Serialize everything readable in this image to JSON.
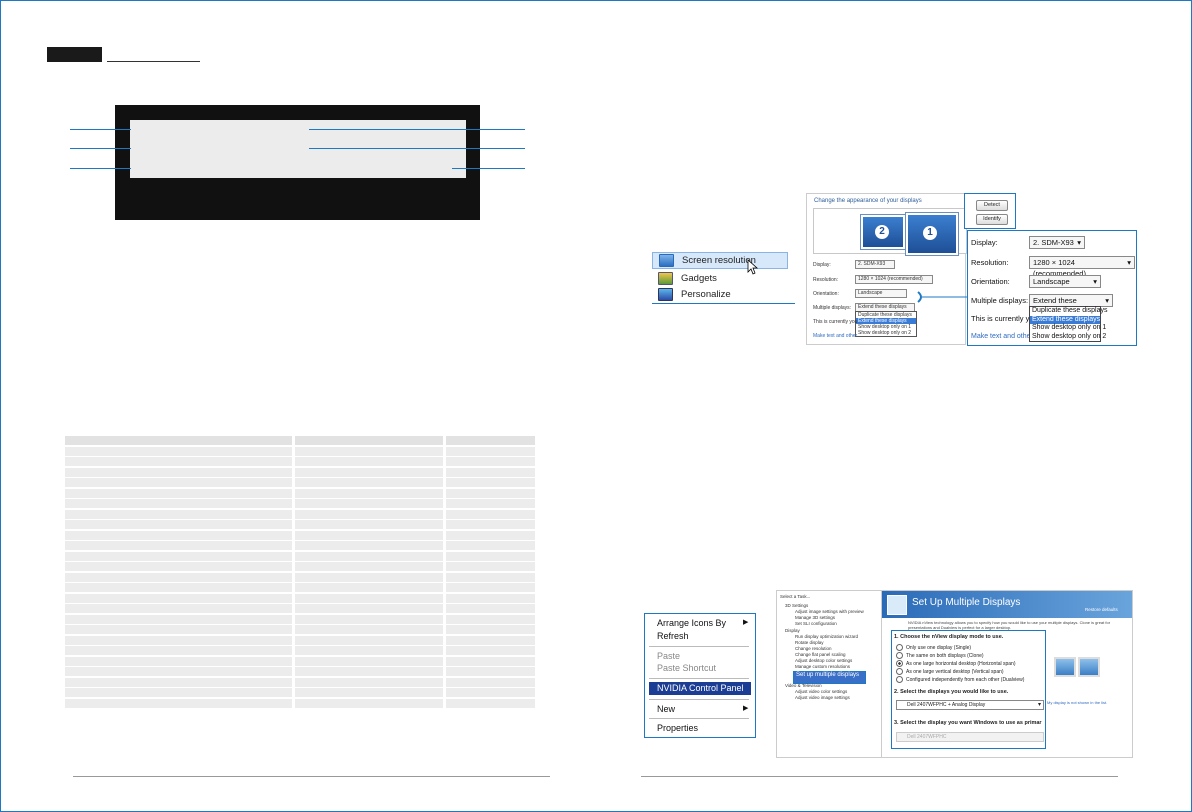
{
  "right_top": {
    "context_menu": {
      "items": [
        {
          "label": "Screen resolution",
          "icon": "screen-resolution-icon"
        },
        {
          "label": "Gadgets",
          "icon": "gadgets-icon"
        },
        {
          "label": "Personalize",
          "icon": "personalize-icon"
        }
      ]
    },
    "dialog": {
      "title": "Change the appearance of your displays",
      "monitor_1": "1",
      "monitor_2": "2",
      "display_label": "Display:",
      "display_value": "2. SDM-X93",
      "resolution_label": "Resolution:",
      "resolution_value": "1280 × 1024 (recommended)",
      "orientation_label": "Orientation:",
      "orientation_value": "Landscape",
      "multiple_label": "Multiple displays:",
      "multiple_value": "Extend these displays",
      "options": [
        "Duplicate these displays",
        "Extend these displays",
        "Show desktop only on 1",
        "Show desktop only on 2"
      ],
      "currently_text": "This is currently you",
      "link_text": "Make text and other"
    },
    "buttons": {
      "detect": "Detect",
      "identify": "Identify"
    },
    "zoom": {
      "display_label": "Display:",
      "display_value": "2. SDM-X93",
      "resolution_label": "Resolution:",
      "resolution_value": "1280 × 1024 (recommended)",
      "orientation_label": "Orientation:",
      "orientation_value": "Landscape",
      "multiple_label": "Multiple displays:",
      "multiple_value": "Extend these displays",
      "options": [
        "Duplicate these displays",
        "Extend these displays",
        "Show desktop only on 1",
        "Show desktop only on 2"
      ],
      "currently_text": "This is currently you",
      "link_text": "Make text and other"
    }
  },
  "right_bottom": {
    "context_menu": {
      "arrange": "Arrange Icons By",
      "refresh": "Refresh",
      "paste": "Paste",
      "paste_shortcut": "Paste Shortcut",
      "nvidia": "NVIDIA Control Panel",
      "new": "New",
      "properties": "Properties"
    },
    "tree": {
      "header": "Select a Task...",
      "items": [
        "3D Settings",
        "Adjust image settings with preview",
        "Manage 3D settings",
        "Set SLI configuration",
        "Display",
        "Run display optimization wizard",
        "Rotate display",
        "Change resolution",
        "Change flat panel scaling",
        "Adjust desktop color settings",
        "Manage custom resolutions",
        "Set up multiple displays",
        "Video & Television",
        "Adjust video color settings",
        "Adjust video image settings"
      ]
    },
    "panel": {
      "title": "Set Up Multiple Displays",
      "restore": "Restore defaults",
      "intro": "NVIDIA nView technology allows you to specify how you would like to use your multiple displays. Clone is great for presentations and Dualview is perfect for a larger desktop.",
      "step1": "1. Choose the nView display mode to use.",
      "modes": [
        "Only use one display (Single)",
        "The same on both displays (Clone)",
        "As one large horizontal desktop (Horizontal span)",
        "As one large vertical desktop (Vertical span)",
        "Configured independently from each other (Dualview)"
      ],
      "step2": "2. Select the displays you would like to use.",
      "display_select": "Dell 2407WFPHC + Analog Display",
      "step3": "3. Select the display you want Windows to use as primar",
      "primary_select": "Dell 2407WFPHC",
      "note": "My display is not shown in the list."
    }
  }
}
